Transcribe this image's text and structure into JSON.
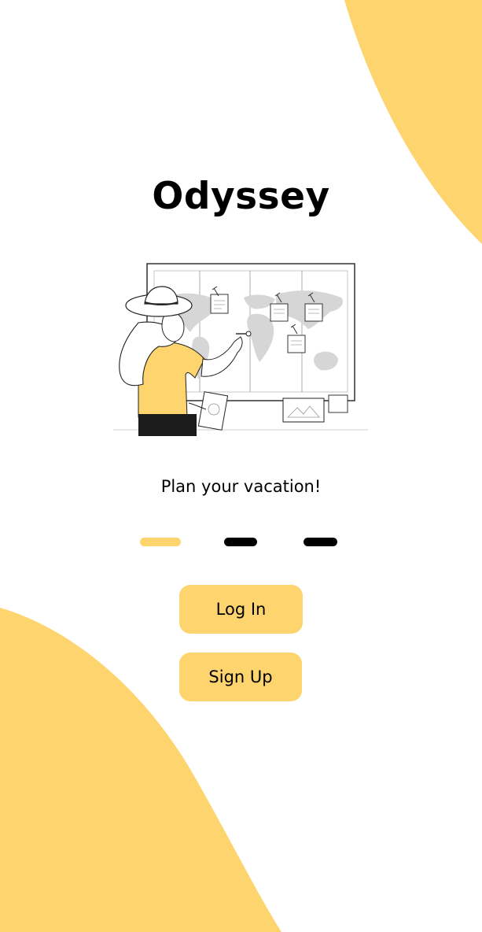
{
  "app": {
    "title": "Odyssey",
    "tagline": "Plan your vacation!"
  },
  "pager": {
    "pages": 3,
    "active_index": 0
  },
  "actions": {
    "login_label": "Log In",
    "signup_label": "Sign Up"
  },
  "illustration": {
    "subject": "traveler-pinning-world-map"
  },
  "colors": {
    "accent": "#fdd46e",
    "background": "#ffffff",
    "text": "#000000",
    "dot_inactive": "#000000",
    "map_land": "#d6d6d6",
    "outline": "#222222"
  }
}
